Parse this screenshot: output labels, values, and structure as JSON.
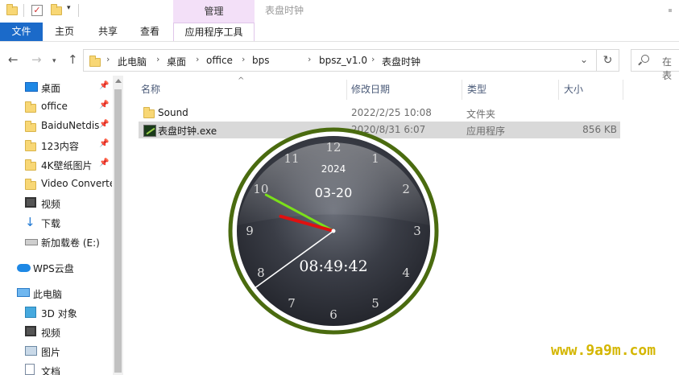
{
  "titlebar": {
    "manage_tab": "管理",
    "title": "表盘时钟"
  },
  "ribbon": {
    "tabs": [
      "文件",
      "主页",
      "共享",
      "查看",
      "应用程序工具"
    ]
  },
  "address": {
    "crumbs": [
      "此电脑",
      "桌面",
      "office",
      "bps",
      "bpsz_v1.0",
      "表盘时钟"
    ],
    "search_placeholder": "在 表"
  },
  "nav": {
    "quick_access": [
      {
        "label": "桌面",
        "icon": "desktop-icon",
        "pinned": true
      },
      {
        "label": "office",
        "icon": "folder-icon",
        "pinned": true
      },
      {
        "label": "BaiduNetdis",
        "icon": "folder-icon",
        "pinned": true
      },
      {
        "label": "123内容",
        "icon": "folder-icon",
        "pinned": true
      },
      {
        "label": "4K壁纸图片",
        "icon": "folder-icon",
        "pinned": true
      },
      {
        "label": "Video Converte",
        "icon": "folder-icon",
        "pinned": false
      },
      {
        "label": "视频",
        "icon": "video-icon",
        "pinned": false
      },
      {
        "label": "下载",
        "icon": "download-icon",
        "pinned": false
      },
      {
        "label": "新加载卷 (E:)",
        "icon": "drive-icon",
        "pinned": false
      }
    ],
    "wps": "WPS云盘",
    "this_pc": "此电脑",
    "pc_items": [
      {
        "label": "3D 对象",
        "icon": "3d-objects-icon"
      },
      {
        "label": "视频",
        "icon": "video-icon"
      },
      {
        "label": "图片",
        "icon": "pictures-icon"
      },
      {
        "label": "文档",
        "icon": "documents-icon"
      }
    ]
  },
  "columns": {
    "name": "名称",
    "date": "修改日期",
    "type": "类型",
    "size": "大小"
  },
  "files": [
    {
      "name": "Sound",
      "date": "2022/2/25 10:08",
      "type": "文件夹",
      "size": "",
      "icon": "folder-icon",
      "selected": false
    },
    {
      "name": "表盘时钟.exe",
      "date": "2020/8/31 6:07",
      "type": "应用程序",
      "size": "856 KB",
      "icon": "exe-icon",
      "selected": true
    }
  ],
  "clock": {
    "year": "2024",
    "date": "03-20",
    "time": "08:49:42",
    "numerals": [
      "12",
      "1",
      "2",
      "3",
      "4",
      "5",
      "6",
      "7",
      "8",
      "9",
      "10",
      "11"
    ],
    "hour": 8,
    "minute": 49,
    "second": 42,
    "colors": {
      "ring": "#4a6b0f",
      "hour_hand": "#e01010",
      "minute_hand": "#7be01a",
      "second_hand": "#ffffff"
    }
  },
  "watermark": "www.9a9m.com"
}
